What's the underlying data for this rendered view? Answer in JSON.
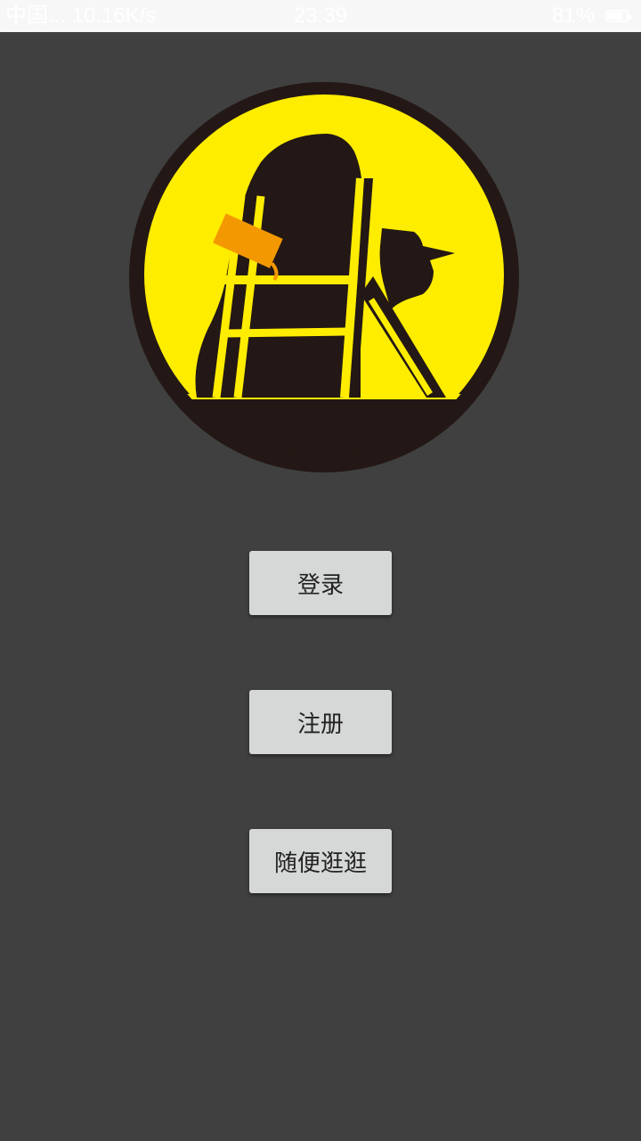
{
  "status_bar": {
    "network_speed": "中国... 10.16K/s",
    "time": "23:39",
    "battery_percent_text": "81%",
    "battery_level": 0.81,
    "icons": [
      "battery-icon"
    ]
  },
  "logo": {
    "icon": "concrete-mixer-worker-logo",
    "colors": {
      "circle_border": "#231815",
      "background": "#ffed00",
      "figure": "#231815",
      "tag": "#f39800"
    }
  },
  "buttons": {
    "login_label": "登录",
    "register_label": "注册",
    "browse_label": "随便逛逛"
  },
  "colors": {
    "page_background": "#404040",
    "button_background": "#d6d7d7",
    "button_text": "#222222"
  }
}
